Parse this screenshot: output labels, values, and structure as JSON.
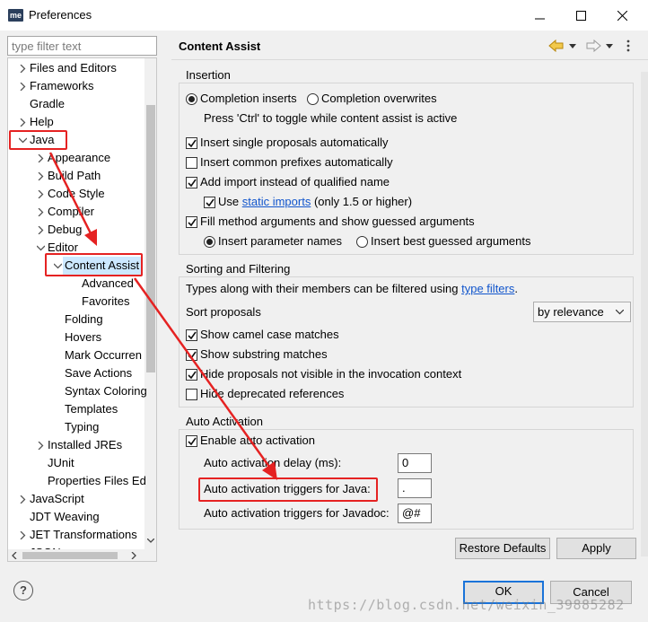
{
  "window": {
    "app_icon_text": "me",
    "title": "Preferences"
  },
  "filter": {
    "placeholder": "type filter text"
  },
  "tree": {
    "items": [
      {
        "label": "Files and Editors",
        "state": "collapsed"
      },
      {
        "label": "Frameworks",
        "state": "collapsed"
      },
      {
        "label": "Gradle",
        "state": "leaf"
      },
      {
        "label": "Help",
        "state": "collapsed"
      },
      {
        "label": "Java",
        "state": "expanded"
      },
      {
        "label": "Appearance",
        "state": "collapsed"
      },
      {
        "label": "Build Path",
        "state": "collapsed"
      },
      {
        "label": "Code Style",
        "state": "collapsed"
      },
      {
        "label": "Compiler",
        "state": "collapsed"
      },
      {
        "label": "Debug",
        "state": "collapsed"
      },
      {
        "label": "Editor",
        "state": "expanded"
      },
      {
        "label": "Content Assist",
        "state": "expanded"
      },
      {
        "label": "Advanced",
        "state": "leaf"
      },
      {
        "label": "Favorites",
        "state": "leaf"
      },
      {
        "label": "Folding",
        "state": "leaf"
      },
      {
        "label": "Hovers",
        "state": "leaf"
      },
      {
        "label": "Mark Occurren",
        "state": "leaf"
      },
      {
        "label": "Save Actions",
        "state": "leaf"
      },
      {
        "label": "Syntax Coloring",
        "state": "leaf"
      },
      {
        "label": "Templates",
        "state": "leaf"
      },
      {
        "label": "Typing",
        "state": "leaf"
      },
      {
        "label": "Installed JREs",
        "state": "collapsed"
      },
      {
        "label": "JUnit",
        "state": "leaf"
      },
      {
        "label": "Properties Files Ed",
        "state": "leaf"
      },
      {
        "label": "JavaScript",
        "state": "collapsed"
      },
      {
        "label": "JDT Weaving",
        "state": "leaf"
      },
      {
        "label": "JET Transformations",
        "state": "collapsed"
      },
      {
        "label": "JSON",
        "state": "collapsed"
      }
    ]
  },
  "page": {
    "title": "Content Assist",
    "insertion": {
      "label": "Insertion",
      "completion_inserts": "Completion inserts",
      "completion_overwrites": "Completion overwrites",
      "hint": "Press 'Ctrl' to toggle while content assist is active",
      "insert_single": "Insert single proposals automatically",
      "insert_common": "Insert common prefixes automatically",
      "add_import": "Add import instead of qualified name",
      "use_prefix": "Use",
      "static_imports": "static imports",
      "use_suffix": "(only 1.5 or higher)",
      "fill_args": "Fill method arguments and show guessed arguments",
      "insert_param_names": "Insert parameter names",
      "insert_best_guessed": "Insert best guessed arguments"
    },
    "sorting": {
      "label": "Sorting and Filtering",
      "types_prefix": "Types along with their members can be filtered using",
      "type_filters": "type filters",
      "types_suffix": ".",
      "sort_label": "Sort proposals",
      "sort_value": "by relevance",
      "camel": "Show camel case matches",
      "substring": "Show substring matches",
      "hide_invisible": "Hide proposals not visible in the invocation context",
      "hide_deprecated": "Hide deprecated references"
    },
    "auto": {
      "label": "Auto Activation",
      "enable": "Enable auto activation",
      "delay_label": "Auto activation delay (ms):",
      "delay_value": "0",
      "java_label": "Auto activation triggers for Java:",
      "java_value": ".",
      "javadoc_label": "Auto activation triggers for Javadoc:",
      "javadoc_value": "@#"
    },
    "restore_defaults": "Restore Defaults",
    "apply": "Apply"
  },
  "footer": {
    "help": "?",
    "ok": "OK",
    "cancel": "Cancel"
  },
  "watermark": "https://blog.csdn.net/weixin_39885282",
  "colors": {
    "annotation_red": "#e52222",
    "link_blue": "#1155cc",
    "selection": "#cce8ff",
    "default_button_border": "#1a73d9"
  }
}
